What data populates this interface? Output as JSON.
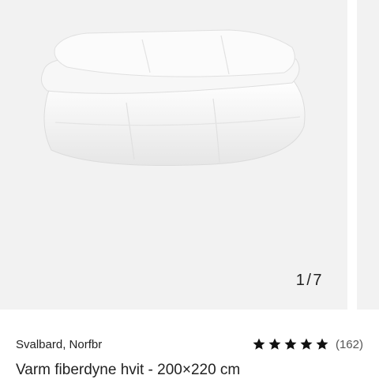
{
  "gallery": {
    "image_alt": "white duvet",
    "counter": {
      "current": "1",
      "separator": "/",
      "total": "7"
    }
  },
  "listing": {
    "seller": "Svalbard, Norfbr",
    "rating": {
      "stars": 5,
      "count_label": "(162)"
    },
    "title": "Varm fiberdyne hvit - 200×220 cm"
  },
  "colors": {
    "background": "#ffffff",
    "image_bg": "#f2f2f2",
    "star": "#111111"
  }
}
